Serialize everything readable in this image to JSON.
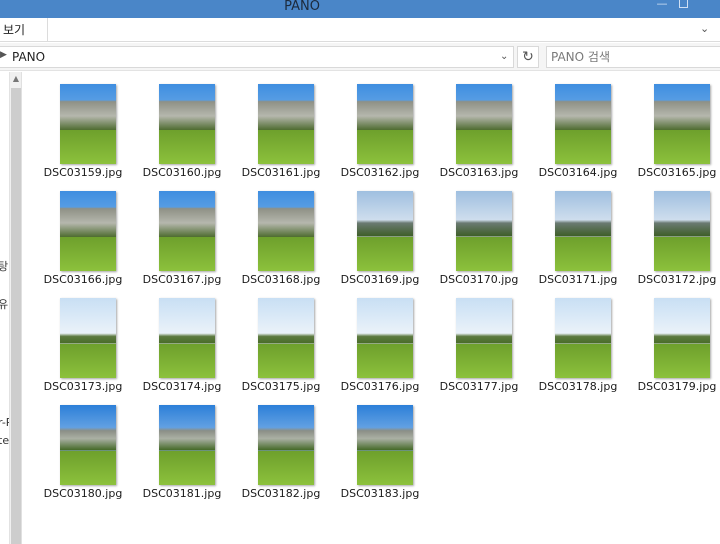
{
  "window": {
    "title": "PANO"
  },
  "ribbon": {
    "view_label": "보기"
  },
  "address": {
    "path": "PANO",
    "search_placeholder": "PANO 검색"
  },
  "nav": {
    "fragments": [
      "탕",
      "유",
      "r-P",
      "te"
    ]
  },
  "files": [
    {
      "name": "DSC03159.jpg",
      "scene": "peak"
    },
    {
      "name": "DSC03160.jpg",
      "scene": "peak"
    },
    {
      "name": "DSC03161.jpg",
      "scene": "peak"
    },
    {
      "name": "DSC03162.jpg",
      "scene": "peak"
    },
    {
      "name": "DSC03163.jpg",
      "scene": "peak"
    },
    {
      "name": "DSC03164.jpg",
      "scene": "peak"
    },
    {
      "name": "DSC03165.jpg",
      "scene": "peak"
    },
    {
      "name": "DSC03166.jpg",
      "scene": "peak"
    },
    {
      "name": "DSC03167.jpg",
      "scene": "peak"
    },
    {
      "name": "DSC03168.jpg",
      "scene": "peak"
    },
    {
      "name": "DSC03169.jpg",
      "scene": "cloudy"
    },
    {
      "name": "DSC03170.jpg",
      "scene": "cloudy"
    },
    {
      "name": "DSC03171.jpg",
      "scene": "cloudy"
    },
    {
      "name": "DSC03172.jpg",
      "scene": "cloudy"
    },
    {
      "name": "DSC03173.jpg",
      "scene": "meadow"
    },
    {
      "name": "DSC03174.jpg",
      "scene": "meadow"
    },
    {
      "name": "DSC03175.jpg",
      "scene": "meadow"
    },
    {
      "name": "DSC03176.jpg",
      "scene": "meadow"
    },
    {
      "name": "DSC03177.jpg",
      "scene": "meadow"
    },
    {
      "name": "DSC03178.jpg",
      "scene": "meadow"
    },
    {
      "name": "DSC03179.jpg",
      "scene": "meadow"
    },
    {
      "name": "DSC03180.jpg",
      "scene": "blue"
    },
    {
      "name": "DSC03181.jpg",
      "scene": "blue"
    },
    {
      "name": "DSC03182.jpg",
      "scene": "blue"
    },
    {
      "name": "DSC03183.jpg",
      "scene": "blue"
    }
  ],
  "colors": {
    "titlebar": "#4a86c8",
    "sky_blue": "#3d8ad6",
    "grass": "#7cb23a"
  }
}
